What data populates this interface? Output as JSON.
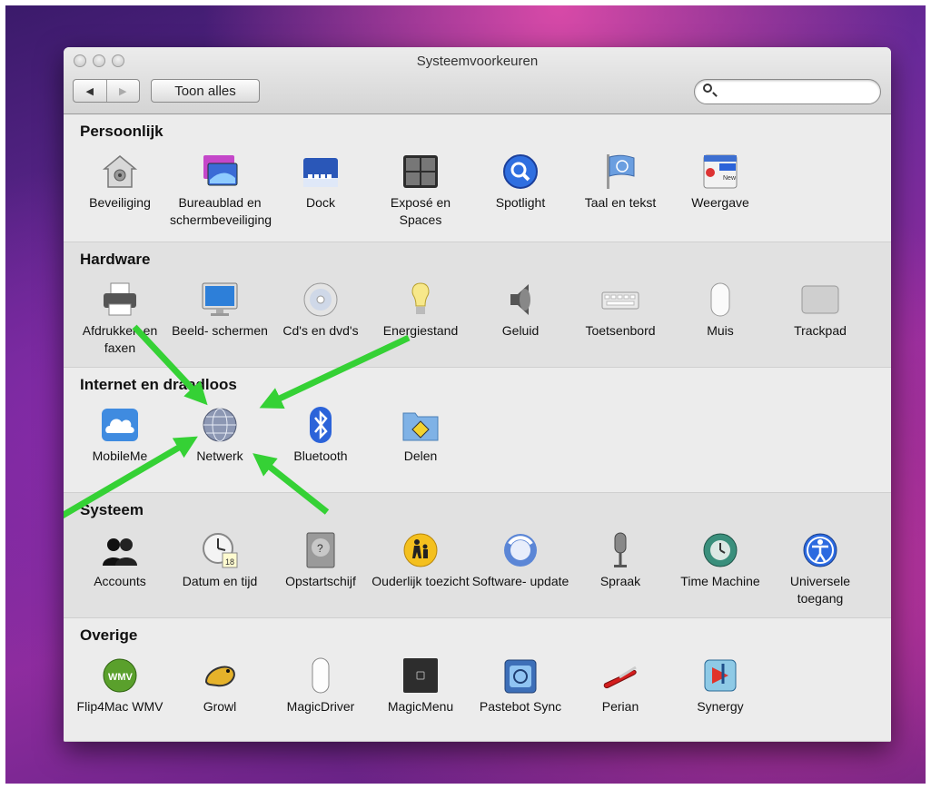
{
  "window": {
    "title": "Systeemvoorkeuren",
    "back_label": "◀",
    "forward_label": "▶",
    "show_all_label": "Toon alles",
    "search_placeholder": ""
  },
  "sections": [
    {
      "heading": "Persoonlijk",
      "items": [
        {
          "label": "Beveiliging",
          "icon": "security-house-icon"
        },
        {
          "label": "Bureaublad en schermbeveiliging",
          "icon": "desktop-screensaver-icon"
        },
        {
          "label": "Dock",
          "icon": "dock-icon"
        },
        {
          "label": "Exposé en Spaces",
          "icon": "expose-spaces-icon"
        },
        {
          "label": "Spotlight",
          "icon": "spotlight-icon"
        },
        {
          "label": "Taal en tekst",
          "icon": "language-flag-icon"
        },
        {
          "label": "Weergave",
          "icon": "appearance-icon"
        }
      ]
    },
    {
      "heading": "Hardware",
      "items": [
        {
          "label": "Afdrukken en faxen",
          "icon": "printer-icon"
        },
        {
          "label": "Beeld- schermen",
          "icon": "display-icon"
        },
        {
          "label": "Cd's en dvd's",
          "icon": "cd-icon"
        },
        {
          "label": "Energiestand",
          "icon": "lightbulb-icon"
        },
        {
          "label": "Geluid",
          "icon": "speaker-icon"
        },
        {
          "label": "Toetsenbord",
          "icon": "keyboard-icon"
        },
        {
          "label": "Muis",
          "icon": "mouse-icon"
        },
        {
          "label": "Trackpad",
          "icon": "trackpad-icon"
        }
      ]
    },
    {
      "heading": "Internet en draadloos",
      "items": [
        {
          "label": "MobileMe",
          "icon": "cloud-icon"
        },
        {
          "label": "Netwerk",
          "icon": "network-globe-icon"
        },
        {
          "label": "Bluetooth",
          "icon": "bluetooth-icon"
        },
        {
          "label": "Delen",
          "icon": "sharing-folder-icon"
        }
      ]
    },
    {
      "heading": "Systeem",
      "items": [
        {
          "label": "Accounts",
          "icon": "accounts-icon"
        },
        {
          "label": "Datum en tijd",
          "icon": "clock-calendar-icon"
        },
        {
          "label": "Opstartschijf",
          "icon": "startup-disk-icon"
        },
        {
          "label": "Ouderlijk toezicht",
          "icon": "parental-controls-icon"
        },
        {
          "label": "Software- update",
          "icon": "software-update-icon"
        },
        {
          "label": "Spraak",
          "icon": "microphone-icon"
        },
        {
          "label": "Time Machine",
          "icon": "time-machine-icon"
        },
        {
          "label": "Universele toegang",
          "icon": "accessibility-icon"
        }
      ]
    },
    {
      "heading": "Overige",
      "items": [
        {
          "label": "Flip4Mac WMV",
          "icon": "wmv-icon"
        },
        {
          "label": "Growl",
          "icon": "growl-icon"
        },
        {
          "label": "MagicDriver",
          "icon": "magic-mouse-icon"
        },
        {
          "label": "MagicMenu",
          "icon": "magicmenu-icon"
        },
        {
          "label": "Pastebot Sync",
          "icon": "pastebot-icon"
        },
        {
          "label": "Perian",
          "icon": "swiss-knife-icon"
        },
        {
          "label": "Synergy",
          "icon": "synergy-icon"
        }
      ]
    }
  ],
  "colors": {
    "arrow": "#33cc33",
    "window_bg": "#ececec",
    "section_alt_bg": "#e1e1e1"
  }
}
